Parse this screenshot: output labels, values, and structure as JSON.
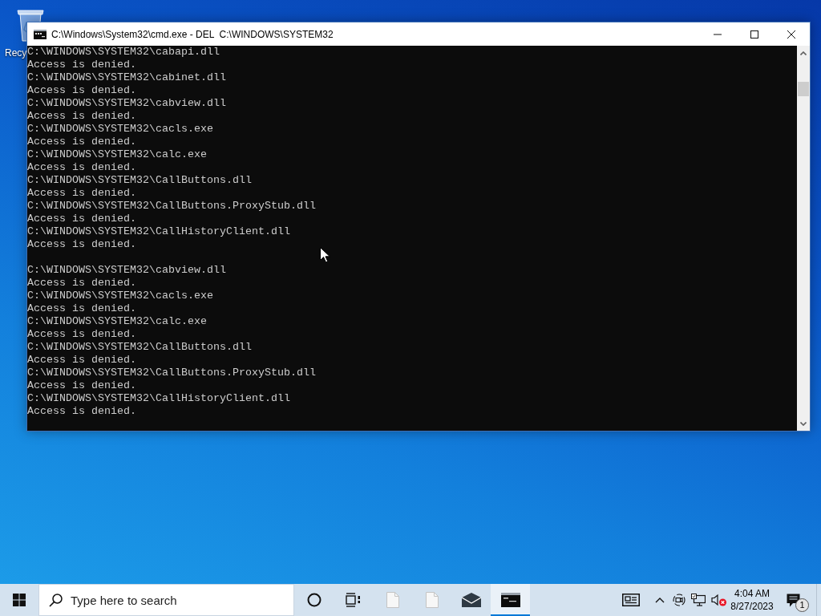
{
  "desktop": {
    "icons": [
      {
        "label": "Recy"
      }
    ]
  },
  "window": {
    "title": "C:\\Windows\\System32\\cmd.exe - DEL  C:\\WINDOWS\\SYSTEM32",
    "console_blocks": [
      {
        "lines": [
          "C:\\WINDOWS\\SYSTEM32\\cabapi.dll",
          "Access is denied.",
          "C:\\WINDOWS\\SYSTEM32\\cabinet.dll",
          "Access is denied.",
          "C:\\WINDOWS\\SYSTEM32\\cabview.dll",
          "Access is denied.",
          "C:\\WINDOWS\\SYSTEM32\\cacls.exe",
          "Access is denied.",
          "C:\\WINDOWS\\SYSTEM32\\calc.exe",
          "Access is denied.",
          "C:\\WINDOWS\\SYSTEM32\\CallButtons.dll",
          "Access is denied.",
          "C:\\WINDOWS\\SYSTEM32\\CallButtons.ProxyStub.dll",
          "Access is denied.",
          "C:\\WINDOWS\\SYSTEM32\\CallHistoryClient.dll",
          "Access is denied."
        ]
      },
      {
        "lines": [
          "C:\\WINDOWS\\SYSTEM32\\cabview.dll",
          "Access is denied.",
          "C:\\WINDOWS\\SYSTEM32\\cacls.exe",
          "Access is denied.",
          "C:\\WINDOWS\\SYSTEM32\\calc.exe",
          "Access is denied.",
          "C:\\WINDOWS\\SYSTEM32\\CallButtons.dll",
          "Access is denied.",
          "C:\\WINDOWS\\SYSTEM32\\CallButtons.ProxyStub.dll",
          "Access is denied.",
          "C:\\WINDOWS\\SYSTEM32\\CallHistoryClient.dll",
          "Access is denied."
        ]
      }
    ]
  },
  "taskbar": {
    "search": {
      "placeholder": "Type here to search"
    },
    "buttons": [
      {
        "kind": "cortana"
      },
      {
        "kind": "task_view"
      }
    ],
    "apps": [
      {
        "kind": "file",
        "selected": false
      },
      {
        "kind": "file",
        "selected": false
      },
      {
        "kind": "mail",
        "selected": false
      },
      {
        "kind": "console",
        "selected": true
      }
    ],
    "tray_icons": [
      {
        "kind": "news"
      },
      {
        "kind": "chevron"
      },
      {
        "kind": "meet"
      },
      {
        "kind": "network"
      },
      {
        "kind": "volume"
      }
    ],
    "clock": {
      "time": "4:04 AM",
      "date": "8/27/2023"
    },
    "notifications": {
      "count": "1"
    }
  }
}
